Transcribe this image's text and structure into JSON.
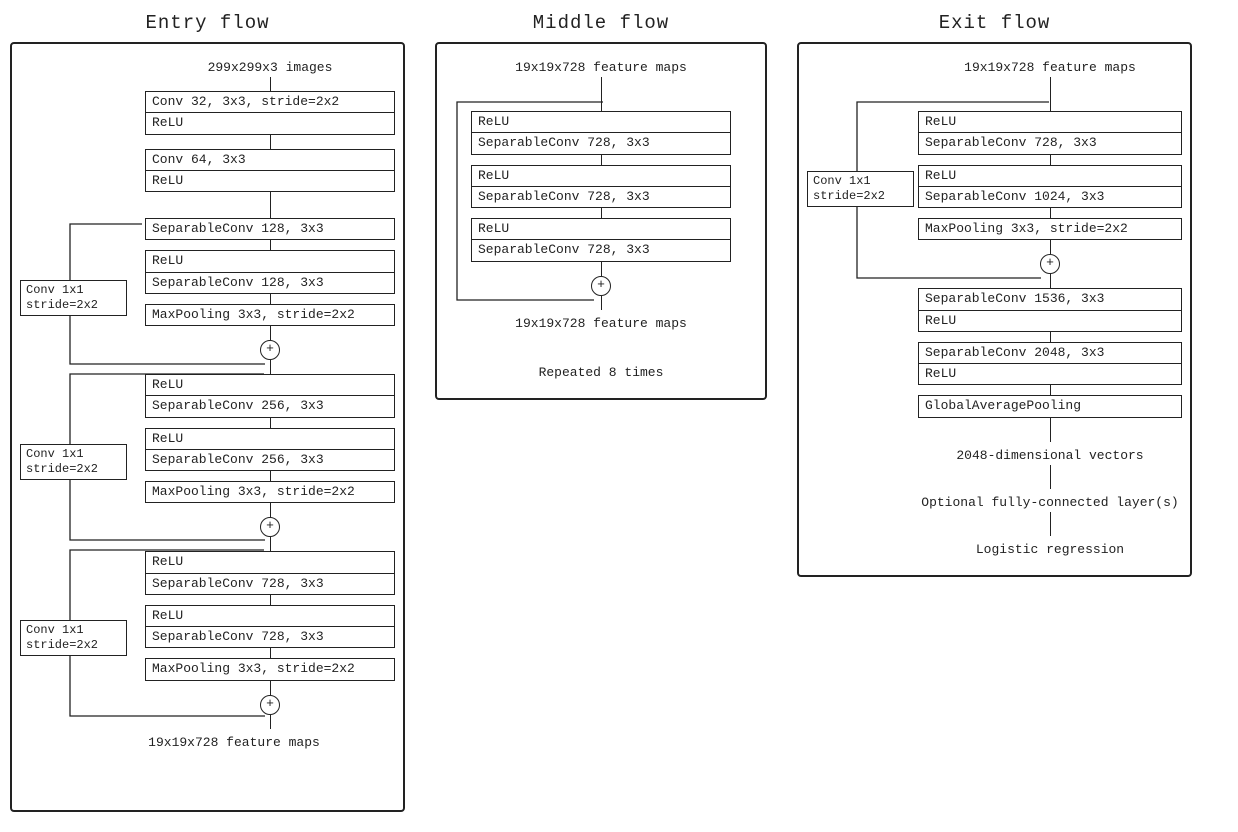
{
  "entry": {
    "title": "Entry flow",
    "input": "299x299x3 images",
    "stem1_a": "Conv 32, 3x3, stride=2x2",
    "stem1_b": "ReLU",
    "stem2_a": "Conv 64, 3x3",
    "stem2_b": "ReLU",
    "skip": {
      "a": "Conv 1x1",
      "b": "stride=2x2"
    },
    "blk1_a": "SeparableConv 128, 3x3",
    "blk1_b": "ReLU",
    "blk1_c": "SeparableConv 128, 3x3",
    "blk1_d": "MaxPooling 3x3, stride=2x2",
    "blk2_a": "ReLU",
    "blk2_b": "SeparableConv 256, 3x3",
    "blk2_c": "ReLU",
    "blk2_d": "SeparableConv 256, 3x3",
    "blk2_e": "MaxPooling 3x3, stride=2x2",
    "blk3_a": "ReLU",
    "blk3_b": "SeparableConv 728, 3x3",
    "blk3_c": "ReLU",
    "blk3_d": "SeparableConv 728, 3x3",
    "blk3_e": "MaxPooling 3x3, stride=2x2",
    "output": "19x19x728 feature maps"
  },
  "middle": {
    "title": "Middle flow",
    "input": "19x19x728 feature maps",
    "b1": "ReLU",
    "b2": "SeparableConv 728, 3x3",
    "b3": "ReLU",
    "b4": "SeparableConv 728, 3x3",
    "b5": "ReLU",
    "b6": "SeparableConv 728, 3x3",
    "output": "19x19x728 feature maps",
    "note": "Repeated 8 times"
  },
  "exit": {
    "title": "Exit flow",
    "input": "19x19x728 feature maps",
    "skip": {
      "a": "Conv 1x1",
      "b": "stride=2x2"
    },
    "b1": "ReLU",
    "b2": "SeparableConv 728, 3x3",
    "b3": "ReLU",
    "b4": "SeparableConv 1024, 3x3",
    "b5": "MaxPooling 3x3, stride=2x2",
    "c1": "SeparableConv 1536, 3x3",
    "c2": "ReLU",
    "c3": "SeparableConv 2048, 3x3",
    "c4": "ReLU",
    "c5": "GlobalAveragePooling",
    "out1": "2048-dimensional vectors",
    "out2": "Optional fully-connected layer(s)",
    "out3": "Logistic regression"
  }
}
